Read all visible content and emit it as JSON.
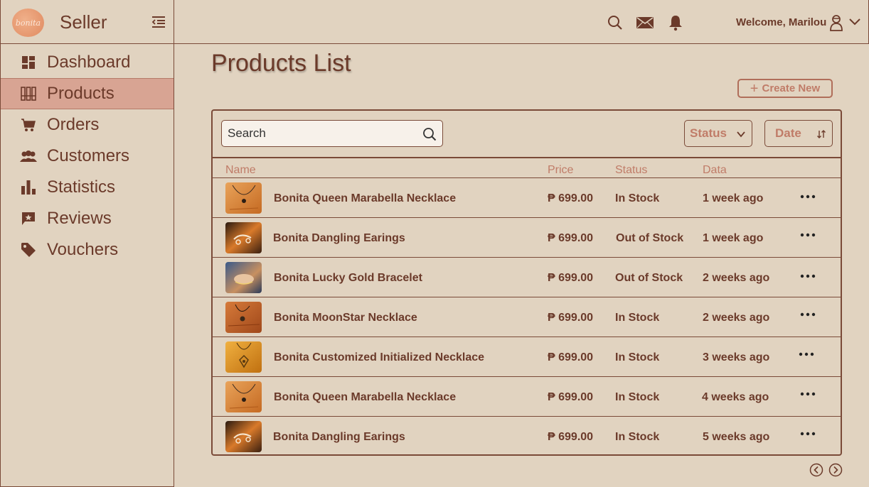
{
  "brand": {
    "logo_text": "bonita",
    "title": "Seller"
  },
  "sidebar": {
    "items": [
      {
        "label": "Dashboard",
        "icon": "dashboard-icon",
        "active": false
      },
      {
        "label": "Products",
        "icon": "products-icon",
        "active": true
      },
      {
        "label": "Orders",
        "icon": "cart-icon",
        "active": false
      },
      {
        "label": "Customers",
        "icon": "customers-icon",
        "active": false
      },
      {
        "label": "Statistics",
        "icon": "bar-chart-icon",
        "active": false
      },
      {
        "label": "Reviews",
        "icon": "review-icon",
        "active": false
      },
      {
        "label": "Vouchers",
        "icon": "tag-icon",
        "active": false
      }
    ]
  },
  "topbar": {
    "welcome": "Welcome, Marilou"
  },
  "main": {
    "title": "Products List",
    "create_label": "Create New",
    "search_placeholder": "Search",
    "status_filter": "Status",
    "date_filter": "Date",
    "columns": [
      "Name",
      "Price",
      "Status",
      "Data"
    ],
    "rows": [
      {
        "name": "Bonita Queen Marabella Necklace",
        "price": "₱ 699.00",
        "status": "In Stock",
        "date": "1 week ago",
        "thumb": "necklace"
      },
      {
        "name": "Bonita Dangling Earings",
        "price": "₱ 699.00",
        "status": "Out of Stock",
        "date": "1 week ago",
        "thumb": "earrings"
      },
      {
        "name": "Bonita Lucky Gold Bracelet",
        "price": "₱ 699.00",
        "status": "Out of Stock",
        "date": "2 weeks ago",
        "thumb": "bracelet"
      },
      {
        "name": "Bonita MoonStar Necklace",
        "price": "₱ 699.00",
        "status": "In Stock",
        "date": "2 weeks ago",
        "thumb": "necklace"
      },
      {
        "name": "Bonita Customized Initialized Necklace",
        "price": "₱ 699.00",
        "status": "In Stock",
        "date": "3 weeks ago",
        "thumb": "pendant"
      },
      {
        "name": "Bonita Queen Marabella Necklace",
        "price": "₱ 699.00",
        "status": "In Stock",
        "date": "4 weeks ago",
        "thumb": "necklace"
      },
      {
        "name": "Bonita Dangling Earings",
        "price": "₱ 699.00",
        "status": "In Stock",
        "date": "5 weeks ago",
        "thumb": "earrings"
      }
    ]
  },
  "colors": {
    "background": "#e1d3c0",
    "text": "#6b3a2a",
    "accent": "#c07c68",
    "active": "#d8a493"
  }
}
